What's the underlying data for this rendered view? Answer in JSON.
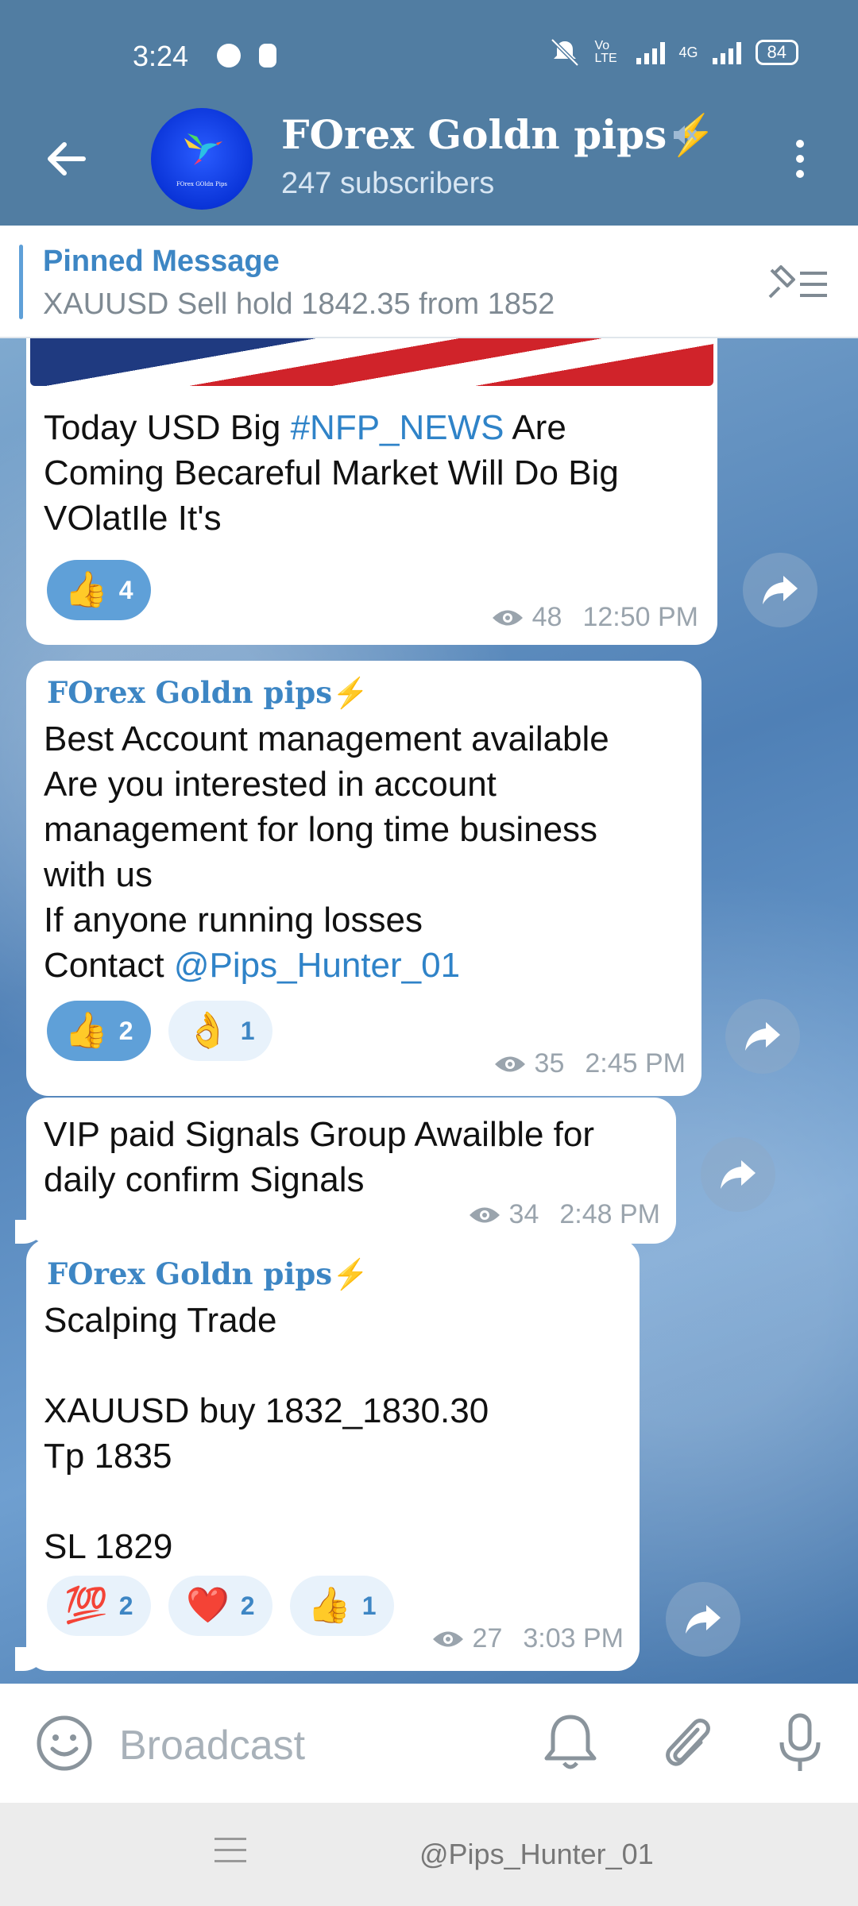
{
  "status_bar": {
    "time": "3:24",
    "battery": "84",
    "network_label": "4G",
    "volte_label": "Vo LTE"
  },
  "header": {
    "channel_name": "FOrex Goldn pips",
    "bolt": "⚡",
    "subscribers": "247 subscribers",
    "avatar_text": "FOrex GOldn Pips",
    "icons": [
      "back-arrow-icon",
      "muted-icon",
      "more-vertical-icon"
    ]
  },
  "pinned": {
    "label": "Pinned Message",
    "text": "XAUUSD Sell hold 1842.35 from 1852"
  },
  "messages": [
    {
      "text_before": "Today USD Big ",
      "hashtag": "#NFP_NEWS",
      "text_after": " Are\nComing Becareful Market Will Do Big\nVOlatIle It's",
      "reactions": [
        {
          "emoji": "👍",
          "count": "4",
          "active": true
        }
      ],
      "views": "48",
      "time": "12:50 PM"
    },
    {
      "sender": "FOrex Goldn pips",
      "text": "Best Account management available\nAre you interested in account\nmanagement for long time business\nwith us\nIf anyone running losses\nContact ",
      "mention": "@Pips_Hunter_01",
      "reactions": [
        {
          "emoji": "👍",
          "count": "2",
          "active": true
        },
        {
          "emoji": "👌",
          "count": "1",
          "active": false
        }
      ],
      "views": "35",
      "time": "2:45 PM"
    },
    {
      "text": "VIP paid Signals Group Awailble for\ndaily confirm Signals",
      "views": "34",
      "time": "2:48 PM"
    },
    {
      "sender": "FOrex Goldn pips",
      "text": "Scalping Trade\n\nXAUUSD buy 1832_1830.30\nTp 1835\n\nSL 1829",
      "reactions": [
        {
          "emoji": "💯",
          "count": "2",
          "active": false
        },
        {
          "emoji": "❤️",
          "count": "2",
          "active": false
        },
        {
          "emoji": "👍",
          "count": "1",
          "active": false
        }
      ],
      "views": "27",
      "time": "3:03 PM"
    }
  ],
  "input": {
    "placeholder": "Broadcast"
  },
  "navbar": {
    "watermark": "@Pips_Hunter_01"
  }
}
